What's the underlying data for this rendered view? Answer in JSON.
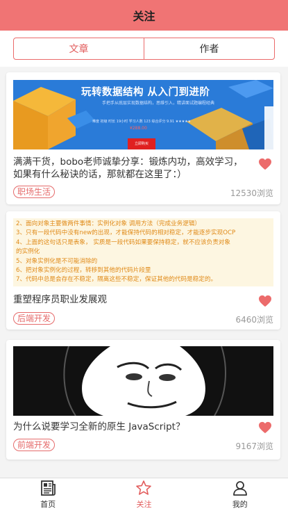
{
  "header": {
    "title": "关注"
  },
  "segment": {
    "tabs": [
      {
        "label": "文章",
        "active": true
      },
      {
        "label": "作者",
        "active": false
      }
    ]
  },
  "articles": [
    {
      "image": {
        "kind": "course-banner",
        "title": "玩转数据结构  从入门到进阶",
        "subtitle": "手把手从底层实现数据结构，思维引入，精讲面试题编程经典",
        "info": "难度 初级  时长 19小时  学习人数 123  综合评分 9.91 ★★★★★",
        "price": "¥288.00",
        "button": "立即购买"
      },
      "title": "满满干货，bobo老师诚挚分享：锻炼内功，高效学习，如果有什么秘诀的话，那就都在这里了：）",
      "tag": "职场生活",
      "views": "12530浏览"
    },
    {
      "image": {
        "kind": "code-notes",
        "lines": [
          "2、面向对象主要做两件事情：实例化对象  调用方法（完成业务逻辑）",
          "3、只有一段代码中没有new的出现，才能保持代码的相对稳定，才能逐步实现OCP",
          "4、上面的这句话只是表象，  实质是一段代码如果要保持稳定，就不应该负责对象",
          "的实例化",
          "5、对象实例化是不可能消除的",
          "6、把对象实例化的过程，转移到其他的代码片段里",
          "7、代码中总是会存在不稳定，隔离这些不稳定，保证其他的代码是稳定的。"
        ]
      },
      "title": "重塑程序员职业发展观",
      "tag": "后端开发",
      "views": "6460浏览"
    },
    {
      "image": {
        "kind": "meme-face"
      },
      "title": "为什么说要学习全新的原生 JavaScript？",
      "tag": "前端开发",
      "views": "9167浏览"
    }
  ],
  "bottom_nav": [
    {
      "label": "首页",
      "icon": "newspaper-icon",
      "active": false
    },
    {
      "label": "关注",
      "icon": "star-icon",
      "active": true
    },
    {
      "label": "我的",
      "icon": "user-icon",
      "active": false
    }
  ],
  "colors": {
    "accent": "#f07474",
    "tag": "#e56a6a",
    "heart": "#ec6b6b",
    "banner_blue": "#2a7bd8",
    "note_bg": "#fdf6e1",
    "note_text": "#e08a18"
  }
}
